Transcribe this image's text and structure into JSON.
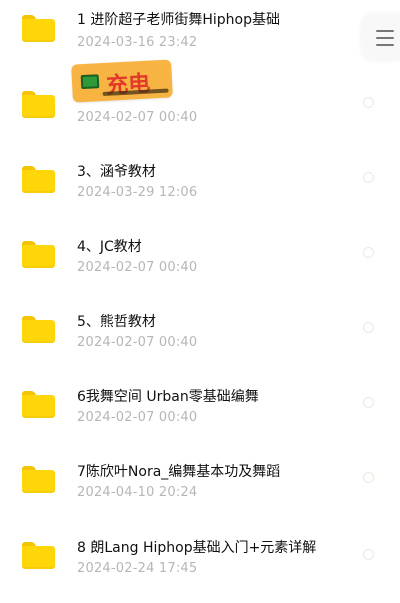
{
  "files": [
    {
      "title": "1 进阶超子老师街舞Hiphop基础",
      "date": "2024-03-16  23:42"
    },
    {
      "title": "",
      "date": "2024-02-07  00:40"
    },
    {
      "title": "3、涵爷教材",
      "date": "2024-03-29  12:06"
    },
    {
      "title": "4、JC教材",
      "date": "2024-02-07  00:40"
    },
    {
      "title": "5、熊哲教材",
      "date": "2024-02-07  00:40"
    },
    {
      "title": "6我舞空间 Urban零基础编舞",
      "date": "2024-02-07  00:40"
    },
    {
      "title": "7陈欣叶Nora_编舞基本功及舞蹈",
      "date": "2024-04-10  20:24"
    },
    {
      "title": "8 朗Lang Hiphop基础入门+元素详解",
      "date": "2024-02-24  17:45"
    }
  ],
  "overlay_badge": {
    "label": "充电"
  },
  "icons": {
    "file_icon": "folder-icon",
    "menu_icon": "hamburger-menu-icon"
  },
  "colors": {
    "folder": "#ffd60a",
    "badge_bg": "#f7b443",
    "badge_text": "#e23a2a"
  }
}
